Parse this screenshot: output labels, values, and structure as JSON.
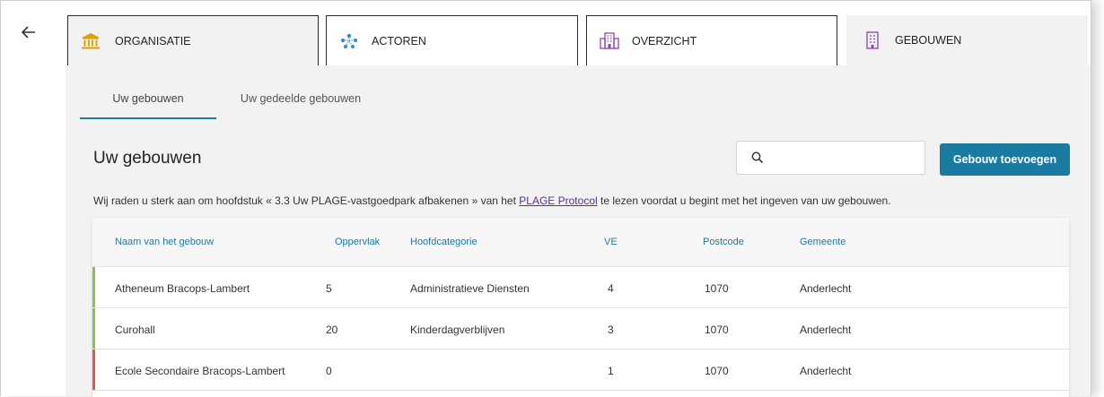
{
  "colors": {
    "accent": "#1b7aa0",
    "ok_bar": "#8bc34a",
    "error_bar": "#e05a4a",
    "link": "#5b2f91"
  },
  "nav": {
    "back_icon": "arrow-left-icon"
  },
  "tabs": [
    {
      "label": "ORGANISATIE",
      "icon": "institution-icon"
    },
    {
      "label": "ACTOREN",
      "icon": "people-network-icon"
    },
    {
      "label": "OVERZICHT",
      "icon": "buildings-icon"
    },
    {
      "label": "GEBOUWEN",
      "icon": "building-icon"
    }
  ],
  "subtabs": [
    {
      "label": "Uw gebouwen"
    },
    {
      "label": "Uw gedeelde gebouwen"
    }
  ],
  "main": {
    "title": "Uw gebouwen",
    "search_placeholder": "",
    "add_button": "Gebouw toevoegen",
    "notice_before": "Wij raden u sterk aan om hoofdstuk « 3.3 Uw PLAGE-vastgoedpark afbakenen » van het ",
    "notice_link": "PLAGE Protocol",
    "notice_after": " te lezen voordat u begint met het ingeven van uw gebouwen."
  },
  "table": {
    "columns": [
      "Naam van het gebouw",
      "Oppervlak",
      "Hoofdcategorie",
      "VE",
      "Postcode",
      "Gemeente"
    ],
    "rows": [
      {
        "name": "Atheneum Bracops-Lambert",
        "area": "5",
        "category": "Administratieve Diensten",
        "ve": "4",
        "postcode": "1070",
        "municipality": "Anderlecht",
        "status": "ok"
      },
      {
        "name": "Curohall",
        "area": "20",
        "category": "Kinderdagverblijven",
        "ve": "3",
        "postcode": "1070",
        "municipality": "Anderlecht",
        "status": "ok"
      },
      {
        "name": "Ecole Secondaire Bracops-Lambert",
        "area": "0",
        "category": "",
        "ve": "1",
        "postcode": "1070",
        "municipality": "Anderlecht",
        "status": "error"
      }
    ]
  }
}
